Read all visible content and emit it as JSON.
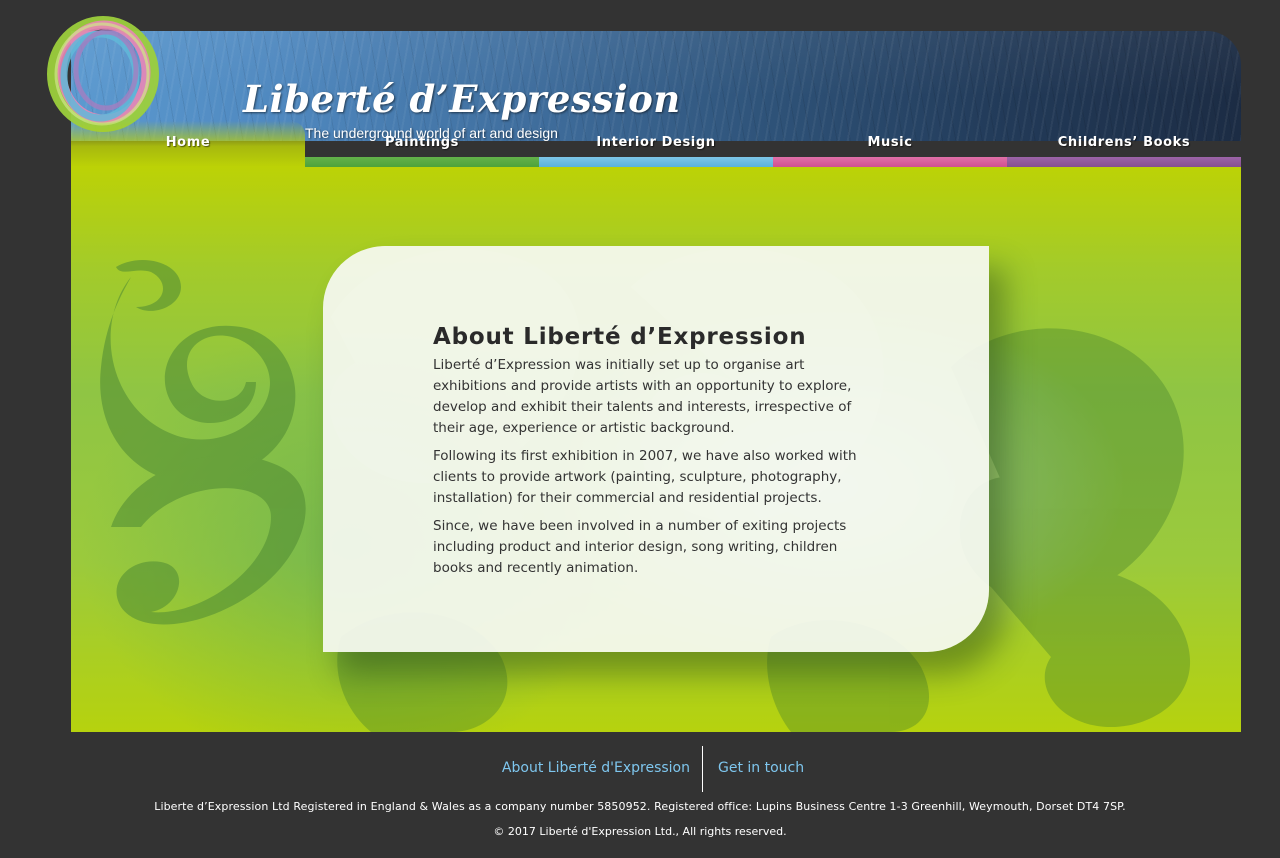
{
  "header": {
    "logo_title": "Liberté d’Expression",
    "tagline": "The underground world of art and design"
  },
  "nav": {
    "items": [
      {
        "label": "Home",
        "active": true,
        "color": "#bcd206"
      },
      {
        "label": "Paintings",
        "color": "#4ea23a"
      },
      {
        "label": "Interior Design",
        "color": "#5ab2dc"
      },
      {
        "label": "Music",
        "color": "#d05090"
      },
      {
        "label": "Childrens’ Books",
        "color": "#86508f"
      }
    ]
  },
  "main": {
    "title": "About Liberté d’Expression",
    "paragraphs": [
      "Liberté d’Expression was initially set up to organise art exhibitions and provide artists with an opportunity to explore, develop and exhibit their talents and interests, irrespective of their age, experience or artistic background.",
      "Following its first exhibition in 2007, we have also worked with clients to provide artwork (painting, sculpture, photography, installation) for their commercial and residential projects.",
      "Since, we have been involved in a number of exiting projects including product and interior design, song writing, children books and recently animation."
    ]
  },
  "footer": {
    "links": [
      "About Liberté d'Expression",
      "Get in touch"
    ],
    "legal": "Liberte d’Expression Ltd Registered in England & Wales as a company number 5850952. Registered office: Lupins Business Centre 1-3 Greenhill, Weymouth, Dorset DT4 7SP.",
    "copyright": "© 2017 Liberté d'Expression Ltd., All rights reserved.",
    "link_color": "#7ec6ee"
  },
  "icons": {
    "logo": "brush-ring-logo-icon"
  }
}
